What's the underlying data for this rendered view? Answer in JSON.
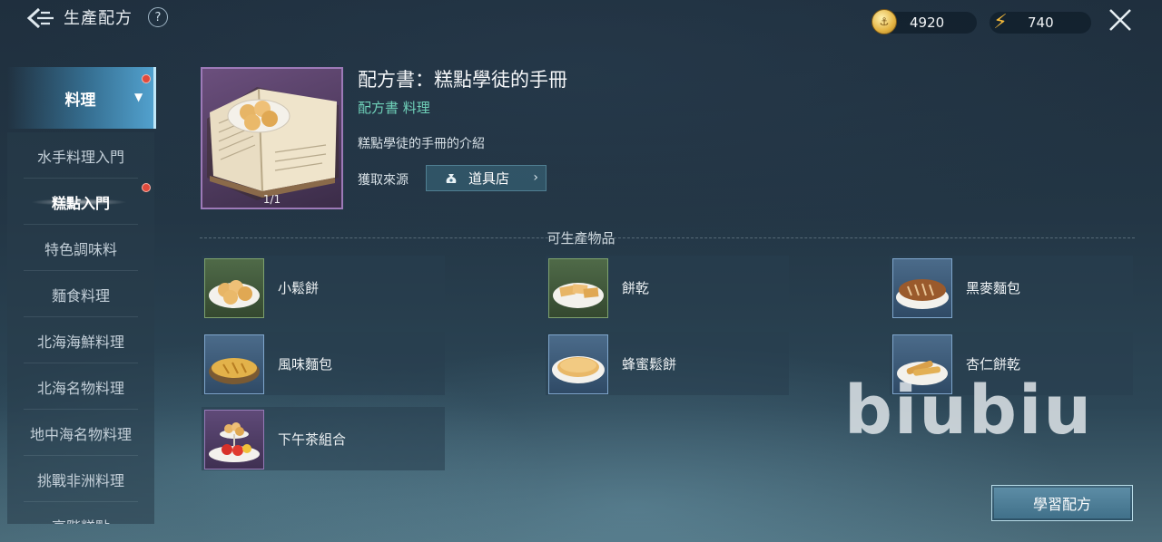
{
  "header": {
    "title": "生產配方",
    "help": "?",
    "coins": "4920",
    "energy": "740"
  },
  "sidebar": {
    "category": "料理",
    "items": [
      {
        "label": "水手料理入門"
      },
      {
        "label": "糕點入門"
      },
      {
        "label": "特色調味料"
      },
      {
        "label": "麵食料理"
      },
      {
        "label": "北海海鮮料理"
      },
      {
        "label": "北海名物料理"
      },
      {
        "label": "地中海名物料理"
      },
      {
        "label": "挑戰非洲料理"
      },
      {
        "label": "高階糕點"
      }
    ]
  },
  "recipe": {
    "name": "配方書：糕點學徒的手冊",
    "category": "配方書 料理",
    "description": "糕點學徒的手冊的介紹",
    "source_label": "獲取來源",
    "source_button": "道具店",
    "count": "1/1"
  },
  "products": {
    "title": "可生產物品",
    "items": [
      {
        "name": "小鬆餅"
      },
      {
        "name": "餅乾"
      },
      {
        "name": "黑麥麵包"
      },
      {
        "name": "風味麵包"
      },
      {
        "name": "蜂蜜鬆餅"
      },
      {
        "name": "杏仁餅乾"
      },
      {
        "name": "下午茶組合"
      }
    ]
  },
  "learn_button": "學習配方",
  "watermark": "biubiu",
  "colors": {
    "accent_green": "#6fd0b8",
    "rarity_green": "#7ea26e",
    "rarity_blue": "#7fa6cc",
    "rarity_purple": "#9679b6",
    "notify_red": "#e04a3c"
  }
}
